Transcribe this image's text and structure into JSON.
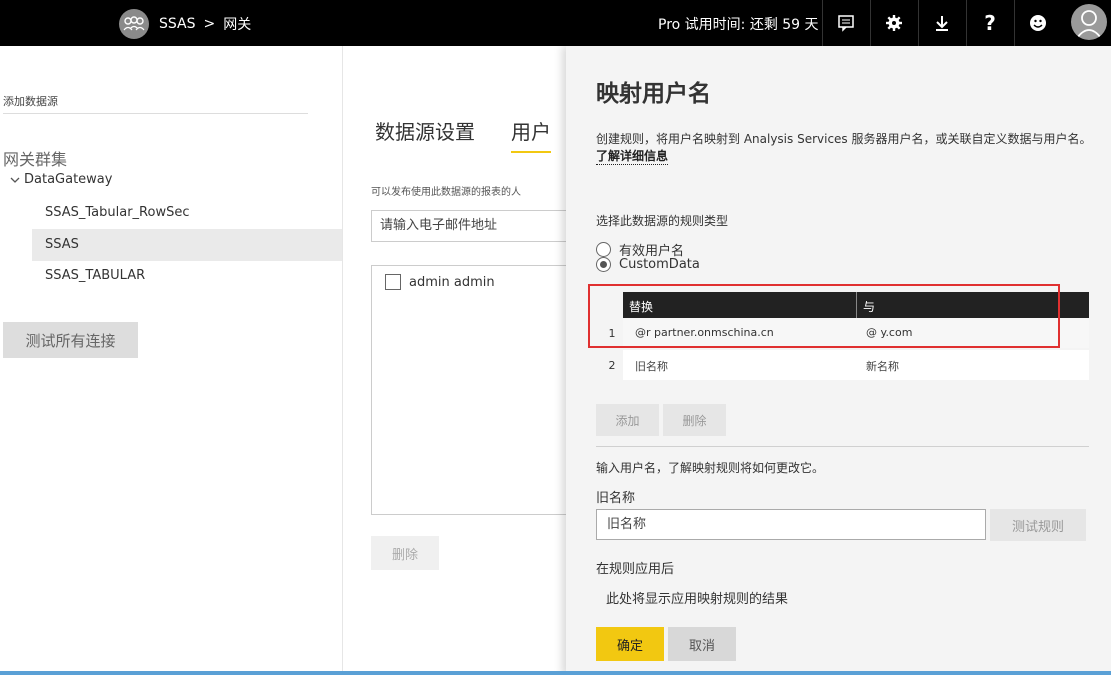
{
  "header": {
    "breadcrumb_root": "SSAS",
    "breadcrumb_sep": ">",
    "breadcrumb_current": "网关",
    "trial_text": "Pro 试用时间: 还剩 59 天",
    "icons": [
      "feedback-icon",
      "gear-icon",
      "download-icon",
      "help-icon",
      "smiley-icon",
      "user-avatar-icon"
    ]
  },
  "leftnav": {
    "add_source": "添加数据源",
    "cluster_title": "网关群集",
    "gateway_name": "DataGateway",
    "datasources": [
      "SSAS_Tabular_RowSec",
      "SSAS",
      "SSAS_TABULAR"
    ],
    "selected_index": 1,
    "test_all_label": "测试所有连接"
  },
  "content": {
    "tabs": [
      "数据源设置",
      "用户"
    ],
    "active_tab": 1,
    "publish_label": "可以发布使用此数据源的报表的人",
    "email_placeholder": "请输入电子邮件地址",
    "users": [
      "admin admin"
    ],
    "delete_label": "删除"
  },
  "panel": {
    "title": "映射用户名",
    "description": "创建规则，将用户名映射到 Analysis Services 服务器用户名，或关联自定义数据与用户名。",
    "learn_more": "了解详细信息",
    "rule_type_label": "选择此数据源的规则类型",
    "rule_types": [
      "有效用户名",
      "CustomData"
    ],
    "selected_rule_type": 1,
    "table": {
      "col_replace": "替换",
      "col_with": "与",
      "rows": [
        {
          "num": "1",
          "replace": "@r   partner.onmschina.cn",
          "with": "@   y.com"
        },
        {
          "num": "2",
          "replace": "旧名称",
          "with": "新名称"
        }
      ]
    },
    "add_label": "添加",
    "delete_label": "删除",
    "enter_username_text": "输入用户名，了解映射规则将如何更改它。",
    "old_name_label": "旧名称",
    "old_name_placeholder": "旧名称",
    "test_rule_label": "测试规则",
    "after_rule_label": "在规则应用后",
    "result_text": "此处将显示应用映射规则的结果",
    "ok_label": "确定",
    "cancel_label": "取消"
  },
  "colors": {
    "topbar": "#000000",
    "accent_yellow": "#f2c811",
    "highlight_red": "#e03030",
    "panel_bg": "#f4f4f4"
  }
}
